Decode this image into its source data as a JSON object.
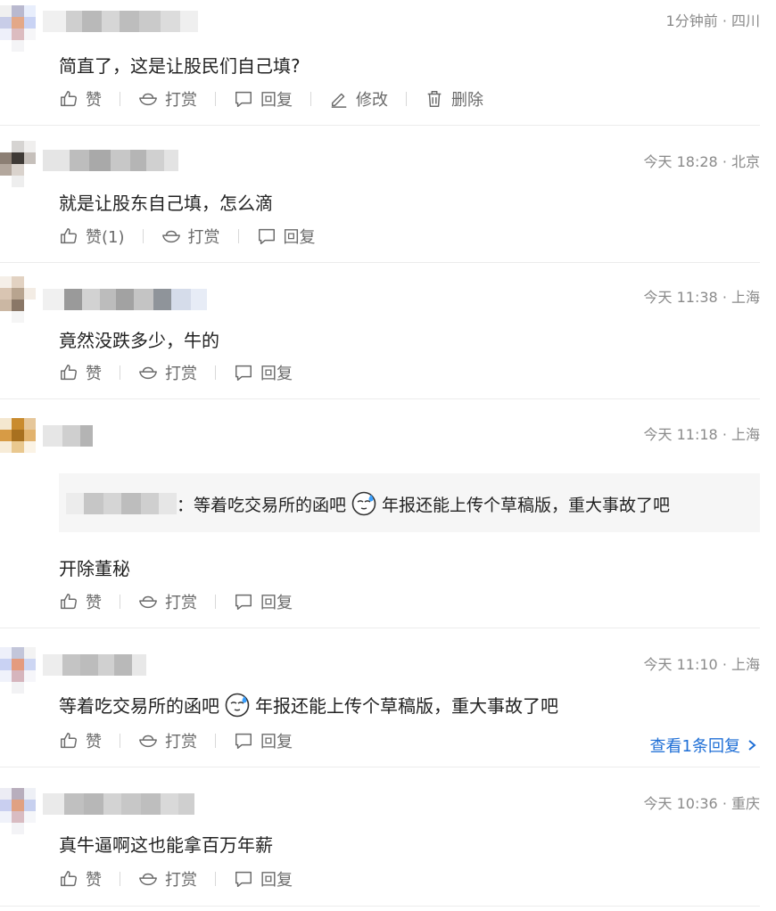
{
  "comments": [
    {
      "meta": "1分钟前 · 四川",
      "content": "简直了，这是让股民们自己填?",
      "actions": {
        "like": "赞",
        "tip": "打赏",
        "reply": "回复",
        "edit": "修改",
        "delete": "删除"
      }
    },
    {
      "meta": "今天 18:28 · 北京",
      "content": "就是让股东自己填，怎么滴",
      "actions": {
        "like": "赞(1)",
        "tip": "打赏",
        "reply": "回复"
      }
    },
    {
      "meta": "今天 11:38 · 上海",
      "content": "竟然没跌多少，牛的",
      "actions": {
        "like": "赞",
        "tip": "打赏",
        "reply": "回复"
      }
    },
    {
      "meta": "今天 11:18 · 上海",
      "quote": {
        "sep": "：",
        "before": "等着吃交易所的函吧",
        "after": "年报还能上传个草稿版，重大事故了吧"
      },
      "content": "开除董秘",
      "actions": {
        "like": "赞",
        "tip": "打赏",
        "reply": "回复"
      }
    },
    {
      "meta": "今天 11:10 · 上海",
      "content_before": "等着吃交易所的函吧",
      "content_after": "年报还能上传个草稿版，重大事故了吧",
      "actions": {
        "like": "赞",
        "tip": "打赏",
        "reply": "回复"
      },
      "view_replies": "查看1条回复"
    },
    {
      "meta": "今天 10:36 · 重庆",
      "content": "真牛逼啊这也能拿百万年薪",
      "actions": {
        "like": "赞",
        "tip": "打赏",
        "reply": "回复"
      }
    }
  ],
  "icons": {
    "like": "thumbs-up-icon",
    "tip": "ingot-icon",
    "reply": "comment-icon",
    "edit": "pencil-icon",
    "delete": "trash-icon",
    "emoji": "sweat-face-emoji-icon",
    "chevron": "chevron-right-icon"
  },
  "colors": {
    "link": "#1f6fd6",
    "meta": "#8a8a8a",
    "action": "#6b6b6b"
  }
}
